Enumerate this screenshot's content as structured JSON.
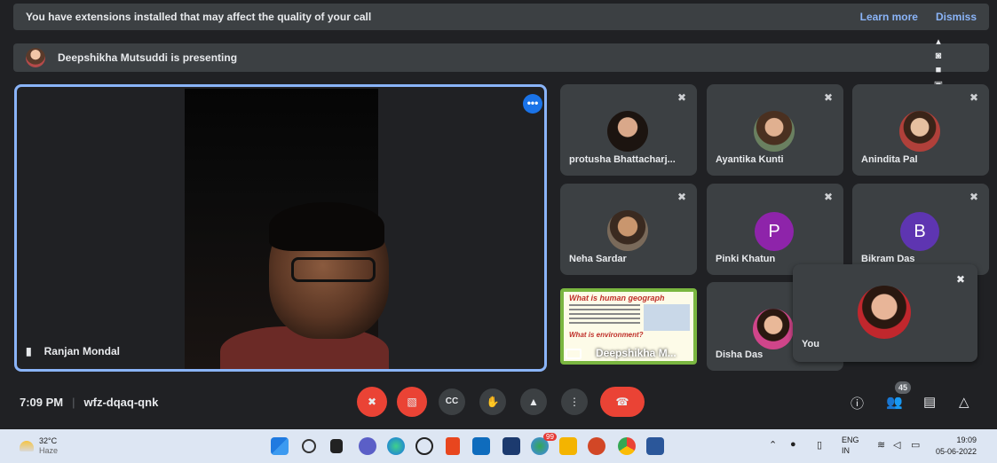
{
  "banner": {
    "message": "You have extensions installed that may affect the quality of your call",
    "learn_more": "Learn more",
    "dismiss": "Dismiss"
  },
  "presenting": {
    "text": "Deepshikha Mutsuddi is presenting"
  },
  "main_tile": {
    "name": "Ranjan Mondal",
    "more_icon": "more-horiz-icon",
    "pin_icon": "pin-icon"
  },
  "participants": [
    {
      "name": "protusha Bhattacharj...",
      "type": "photo",
      "color": "#3a2a24"
    },
    {
      "name": "Ayantika Kunti",
      "type": "photo",
      "color": "#5e3f30"
    },
    {
      "name": "Anindita Pal",
      "type": "photo",
      "color": "#8a5a40"
    },
    {
      "name": "Neha Sardar",
      "type": "photo",
      "color": "#4d3a2c"
    },
    {
      "name": "Pinki Khatun",
      "type": "letter",
      "letter": "P",
      "color": "#8e24aa"
    },
    {
      "name": "Bikram Das",
      "type": "letter",
      "letter": "B",
      "color": "#5e35b1"
    },
    {
      "name": "Disha Das",
      "type": "photo",
      "color": "#d0458a"
    }
  ],
  "presentation_tile": {
    "name": "Deepshikha M...",
    "slide_title": "What is human geograph",
    "slide_subtitle": "What is environment?"
  },
  "self_tile": {
    "name": "You"
  },
  "meeting": {
    "time": "7:09 PM",
    "code": "wfz-dqaq-qnk"
  },
  "controls": {
    "mic": "mic-off-icon",
    "camera": "camera-off-icon",
    "captions": "CC",
    "hand": "raise-hand-icon",
    "present": "present-icon",
    "more": "more-vert-icon",
    "hangup": "hangup-icon"
  },
  "right_controls": {
    "people_count": "45"
  },
  "taskbar": {
    "temp": "32°C",
    "weather": "Haze",
    "lang1": "ENG",
    "lang2": "IN",
    "time": "19:09",
    "date": "05-06-2022",
    "notif_badge": "99"
  }
}
